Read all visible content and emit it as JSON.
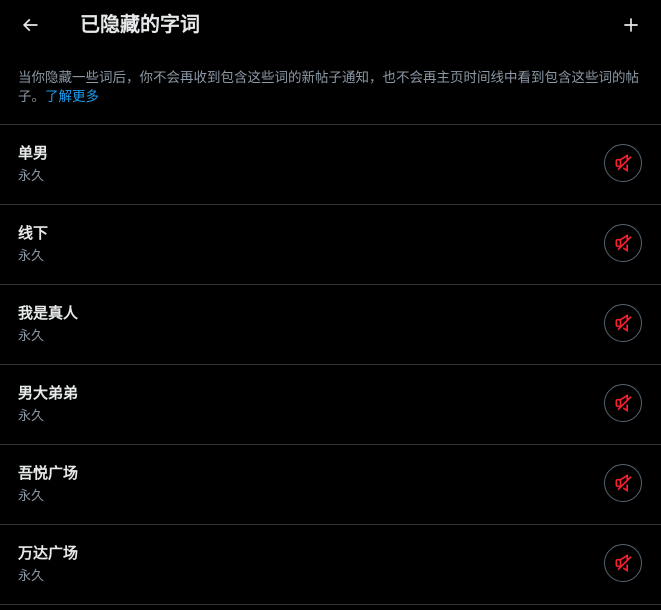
{
  "header": {
    "title": "已隐藏的字词"
  },
  "description": {
    "text": "当你隐藏一些词后，你不会再收到包含这些词的新帖子通知，也不会再主页时间线中看到包含这些词的帖子。",
    "link": "了解更多"
  },
  "muted_words": [
    {
      "word": "单男",
      "duration": "永久"
    },
    {
      "word": "线下",
      "duration": "永久"
    },
    {
      "word": "我是真人",
      "duration": "永久"
    },
    {
      "word": "男大弟弟",
      "duration": "永久"
    },
    {
      "word": "吾悦广场",
      "duration": "永久"
    },
    {
      "word": "万达广场",
      "duration": "永久"
    }
  ],
  "colors": {
    "background": "#000000",
    "text_primary": "#e7e9ea",
    "text_secondary": "#8b98a5",
    "link": "#1d9bf0",
    "mute_icon": "#f4212e",
    "divider": "#2f3336"
  },
  "icons": {
    "back": "arrow-left-icon",
    "add": "plus-icon",
    "unmute": "speaker-muted-icon"
  }
}
